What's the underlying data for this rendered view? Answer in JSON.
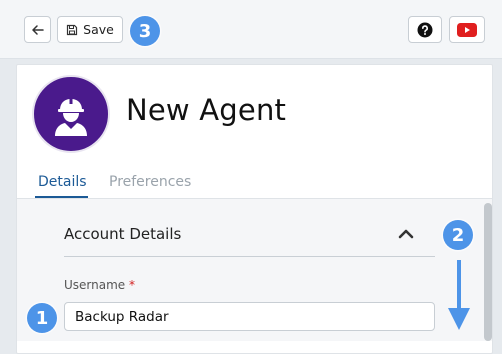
{
  "toolbar": {
    "back_icon": "arrow-left-icon",
    "save_icon": "floppy-disk-icon",
    "save_label": "Save",
    "help_icon": "question-circle-icon",
    "youtube_icon": "youtube-play-icon",
    "youtube_color": "#e01f1f"
  },
  "callouts": {
    "one": "1",
    "two": "2",
    "three": "3",
    "color": "#4d94e8"
  },
  "agent": {
    "title": "New Agent",
    "avatar_icon": "construction-worker-icon",
    "avatar_color": "#4a1a8c"
  },
  "tabs": [
    {
      "label": "Details",
      "active": true
    },
    {
      "label": "Preferences",
      "active": false
    }
  ],
  "section": {
    "title": "Account Details",
    "collapse_icon": "chevron-up-icon"
  },
  "fields": {
    "username": {
      "label": "Username",
      "required_mark": "*",
      "value": "Backup Radar"
    }
  }
}
